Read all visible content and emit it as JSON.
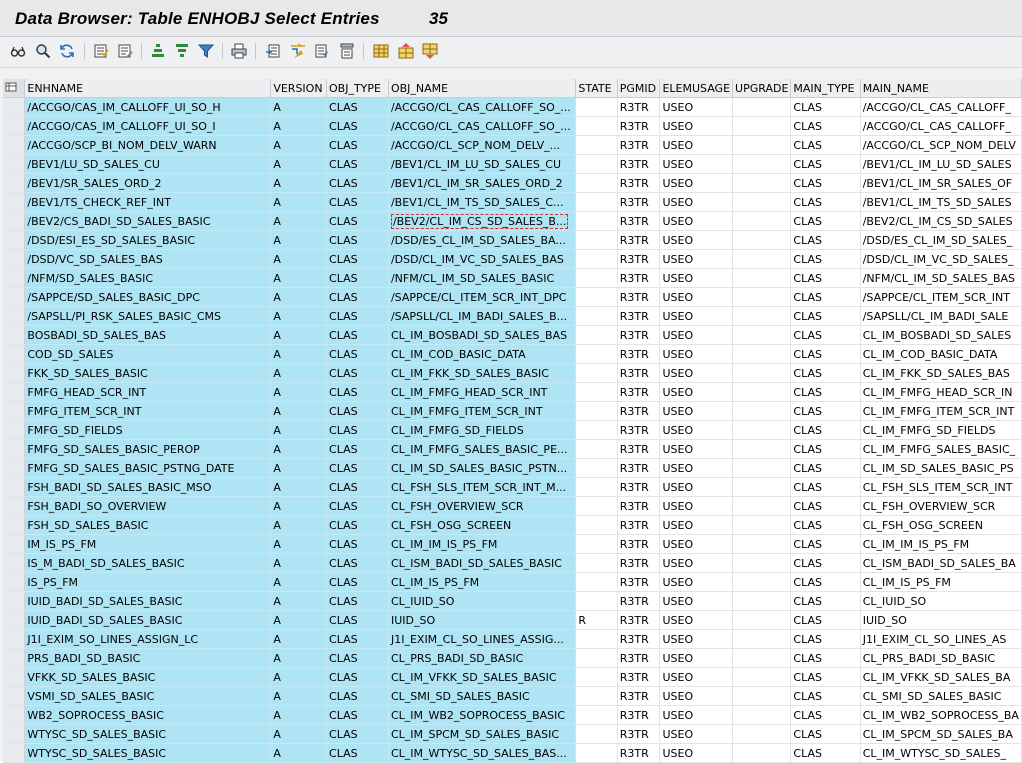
{
  "title": "Data Browser: Table ENHOBJ Select Entries",
  "count": "35",
  "toolbar_icons": [
    "glasses-icon",
    "magnify-icon",
    "refresh-icon",
    "check-table-icon",
    "edit-table-icon",
    "sort-ascending-icon",
    "sort-descending-icon",
    "filter-icon",
    "print-icon",
    "export-icon",
    "arrow-icon",
    "list-icon",
    "layout-icon",
    "grid-icon",
    "grid-up-icon",
    "grid-down-icon"
  ],
  "columns": [
    "ENHNAME",
    "VERSION",
    "OBJ_TYPE",
    "OBJ_NAME",
    "STATE",
    "PGMID",
    "ELEMUSAGE",
    "UPGRADE",
    "MAIN_TYPE",
    "MAIN_NAME"
  ],
  "rows": [
    [
      "/ACCGO/CAS_IM_CALLOFF_UI_SO_H",
      "A",
      "CLAS",
      "/ACCGO/CL_CAS_CALLOFF_SO_...",
      "",
      "R3TR",
      "USEO",
      "",
      "CLAS",
      "/ACCGO/CL_CAS_CALLOFF_"
    ],
    [
      "/ACCGO/CAS_IM_CALLOFF_UI_SO_I",
      "A",
      "CLAS",
      "/ACCGO/CL_CAS_CALLOFF_SO_...",
      "",
      "R3TR",
      "USEO",
      "",
      "CLAS",
      "/ACCGO/CL_CAS_CALLOFF_"
    ],
    [
      "/ACCGO/SCP_BI_NOM_DELV_WARN",
      "A",
      "CLAS",
      "/ACCGO/CL_SCP_NOM_DELV_...",
      "",
      "R3TR",
      "USEO",
      "",
      "CLAS",
      "/ACCGO/CL_SCP_NOM_DELV"
    ],
    [
      "/BEV1/LU_SD_SALES_CU",
      "A",
      "CLAS",
      "/BEV1/CL_IM_LU_SD_SALES_CU",
      "",
      "R3TR",
      "USEO",
      "",
      "CLAS",
      "/BEV1/CL_IM_LU_SD_SALES"
    ],
    [
      "/BEV1/SR_SALES_ORD_2",
      "A",
      "CLAS",
      "/BEV1/CL_IM_SR_SALES_ORD_2",
      "",
      "R3TR",
      "USEO",
      "",
      "CLAS",
      "/BEV1/CL_IM_SR_SALES_OF"
    ],
    [
      "/BEV1/TS_CHECK_REF_INT",
      "A",
      "CLAS",
      "/BEV1/CL_IM_TS_SD_SALES_C...",
      "",
      "R3TR",
      "USEO",
      "",
      "CLAS",
      "/BEV1/CL_IM_TS_SD_SALES"
    ],
    [
      "/BEV2/CS_BADI_SD_SALES_BASIC",
      "A",
      "CLAS",
      "/BEV2/CL_IM_CS_SD_SALES_B...",
      "",
      "R3TR",
      "USEO",
      "",
      "CLAS",
      "/BEV2/CL_IM_CS_SD_SALES"
    ],
    [
      "/DSD/ESI_ES_SD_SALES_BASIC",
      "A",
      "CLAS",
      "/DSD/ES_CL_IM_SD_SALES_BA...",
      "",
      "R3TR",
      "USEO",
      "",
      "CLAS",
      "/DSD/ES_CL_IM_SD_SALES_"
    ],
    [
      "/DSD/VC_SD_SALES_BAS",
      "A",
      "CLAS",
      "/DSD/CL_IM_VC_SD_SALES_BAS",
      "",
      "R3TR",
      "USEO",
      "",
      "CLAS",
      "/DSD/CL_IM_VC_SD_SALES_"
    ],
    [
      "/NFM/SD_SALES_BASIC",
      "A",
      "CLAS",
      "/NFM/CL_IM_SD_SALES_BASIC",
      "",
      "R3TR",
      "USEO",
      "",
      "CLAS",
      "/NFM/CL_IM_SD_SALES_BAS"
    ],
    [
      "/SAPPCE/SD_SALES_BASIC_DPC",
      "A",
      "CLAS",
      "/SAPPCE/CL_ITEM_SCR_INT_DPC",
      "",
      "R3TR",
      "USEO",
      "",
      "CLAS",
      "/SAPPCE/CL_ITEM_SCR_INT"
    ],
    [
      "/SAPSLL/PI_RSK_SALES_BASIC_CMS",
      "A",
      "CLAS",
      "/SAPSLL/CL_IM_BADI_SALES_B...",
      "",
      "R3TR",
      "USEO",
      "",
      "CLAS",
      "/SAPSLL/CL_IM_BADI_SALE"
    ],
    [
      "BOSBADI_SD_SALES_BAS",
      "A",
      "CLAS",
      "CL_IM_BOSBADI_SD_SALES_BAS",
      "",
      "R3TR",
      "USEO",
      "",
      "CLAS",
      "CL_IM_BOSBADI_SD_SALES"
    ],
    [
      "COD_SD_SALES",
      "A",
      "CLAS",
      "CL_IM_COD_BASIC_DATA",
      "",
      "R3TR",
      "USEO",
      "",
      "CLAS",
      "CL_IM_COD_BASIC_DATA"
    ],
    [
      "FKK_SD_SALES_BASIC",
      "A",
      "CLAS",
      "CL_IM_FKK_SD_SALES_BASIC",
      "",
      "R3TR",
      "USEO",
      "",
      "CLAS",
      "CL_IM_FKK_SD_SALES_BAS"
    ],
    [
      "FMFG_HEAD_SCR_INT",
      "A",
      "CLAS",
      "CL_IM_FMFG_HEAD_SCR_INT",
      "",
      "R3TR",
      "USEO",
      "",
      "CLAS",
      "CL_IM_FMFG_HEAD_SCR_IN"
    ],
    [
      "FMFG_ITEM_SCR_INT",
      "A",
      "CLAS",
      "CL_IM_FMFG_ITEM_SCR_INT",
      "",
      "R3TR",
      "USEO",
      "",
      "CLAS",
      "CL_IM_FMFG_ITEM_SCR_INT"
    ],
    [
      "FMFG_SD_FIELDS",
      "A",
      "CLAS",
      "CL_IM_FMFG_SD_FIELDS",
      "",
      "R3TR",
      "USEO",
      "",
      "CLAS",
      "CL_IM_FMFG_SD_FIELDS"
    ],
    [
      "FMFG_SD_SALES_BASIC_PEROP",
      "A",
      "CLAS",
      "CL_IM_FMFG_SALES_BASIC_PE...",
      "",
      "R3TR",
      "USEO",
      "",
      "CLAS",
      "CL_IM_FMFG_SALES_BASIC_"
    ],
    [
      "FMFG_SD_SALES_BASIC_PSTNG_DATE",
      "A",
      "CLAS",
      "CL_IM_SD_SALES_BASIC_PSTN...",
      "",
      "R3TR",
      "USEO",
      "",
      "CLAS",
      "CL_IM_SD_SALES_BASIC_PS"
    ],
    [
      "FSH_BADI_SD_SALES_BASIC_MSO",
      "A",
      "CLAS",
      "CL_FSH_SLS_ITEM_SCR_INT_M...",
      "",
      "R3TR",
      "USEO",
      "",
      "CLAS",
      "CL_FSH_SLS_ITEM_SCR_INT"
    ],
    [
      "FSH_BADI_SO_OVERVIEW",
      "A",
      "CLAS",
      "CL_FSH_OVERVIEW_SCR",
      "",
      "R3TR",
      "USEO",
      "",
      "CLAS",
      "CL_FSH_OVERVIEW_SCR"
    ],
    [
      "FSH_SD_SALES_BASIC",
      "A",
      "CLAS",
      "CL_FSH_OSG_SCREEN",
      "",
      "R3TR",
      "USEO",
      "",
      "CLAS",
      "CL_FSH_OSG_SCREEN"
    ],
    [
      "IM_IS_PS_FM",
      "A",
      "CLAS",
      "CL_IM_IM_IS_PS_FM",
      "",
      "R3TR",
      "USEO",
      "",
      "CLAS",
      "CL_IM_IM_IS_PS_FM"
    ],
    [
      "IS_M_BADI_SD_SALES_BASIC",
      "A",
      "CLAS",
      "CL_ISM_BADI_SD_SALES_BASIC",
      "",
      "R3TR",
      "USEO",
      "",
      "CLAS",
      "CL_ISM_BADI_SD_SALES_BA"
    ],
    [
      "IS_PS_FM",
      "A",
      "CLAS",
      "CL_IM_IS_PS_FM",
      "",
      "R3TR",
      "USEO",
      "",
      "CLAS",
      "CL_IM_IS_PS_FM"
    ],
    [
      "IUID_BADI_SD_SALES_BASIC",
      "A",
      "CLAS",
      "CL_IUID_SO",
      "",
      "R3TR",
      "USEO",
      "",
      "CLAS",
      "CL_IUID_SO"
    ],
    [
      "IUID_BADI_SD_SALES_BASIC",
      "A",
      "CLAS",
      "IUID_SO",
      "R",
      "R3TR",
      "USEO",
      "",
      "CLAS",
      "IUID_SO"
    ],
    [
      "J1I_EXIM_SO_LINES_ASSIGN_LC",
      "A",
      "CLAS",
      "J1I_EXIM_CL_SO_LINES_ASSIG...",
      "",
      "R3TR",
      "USEO",
      "",
      "CLAS",
      "J1I_EXIM_CL_SO_LINES_AS"
    ],
    [
      "PRS_BADI_SD_BASIC",
      "A",
      "CLAS",
      "CL_PRS_BADI_SD_BASIC",
      "",
      "R3TR",
      "USEO",
      "",
      "CLAS",
      "CL_PRS_BADI_SD_BASIC"
    ],
    [
      "VFKK_SD_SALES_BASIC",
      "A",
      "CLAS",
      "CL_IM_VFKK_SD_SALES_BASIC",
      "",
      "R3TR",
      "USEO",
      "",
      "CLAS",
      "CL_IM_VFKK_SD_SALES_BA"
    ],
    [
      "VSMI_SD_SALES_BASIC",
      "A",
      "CLAS",
      "CL_SMI_SD_SALES_BASIC",
      "",
      "R3TR",
      "USEO",
      "",
      "CLAS",
      "CL_SMI_SD_SALES_BASIC"
    ],
    [
      "WB2_SOPROCESS_BASIC",
      "A",
      "CLAS",
      "CL_IM_WB2_SOPROCESS_BASIC",
      "",
      "R3TR",
      "USEO",
      "",
      "CLAS",
      "CL_IM_WB2_SOPROCESS_BA"
    ],
    [
      "WTYSC_SD_SALES_BASIC",
      "A",
      "CLAS",
      "CL_IM_SPCM_SD_SALES_BASIC",
      "",
      "R3TR",
      "USEO",
      "",
      "CLAS",
      "CL_IM_SPCM_SD_SALES_BA"
    ],
    [
      "WTYSC_SD_SALES_BASIC",
      "A",
      "CLAS",
      "CL_IM_WTYSC_SD_SALES_BAS...",
      "",
      "R3TR",
      "USEO",
      "",
      "CLAS",
      "CL_IM_WTYSC_SD_SALES_"
    ]
  ]
}
